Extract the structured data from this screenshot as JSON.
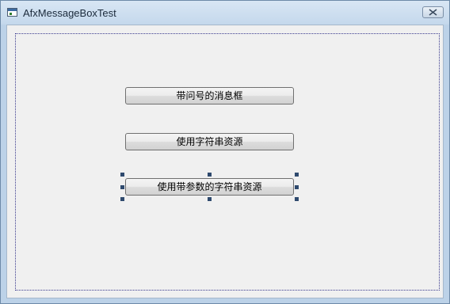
{
  "window": {
    "title": "AfxMessageBoxTest",
    "icons": {
      "app": "application-window-icon",
      "close": "close-x-icon"
    }
  },
  "dialog": {
    "buttons": [
      {
        "label": "带问号的消息框"
      },
      {
        "label": "使用字符串资源"
      },
      {
        "label": "使用带参数的字符串资源"
      }
    ],
    "selected_button_index": 2
  },
  "colors": {
    "title_bar": "#c4d8ec",
    "client_background": "#f0f0f0",
    "selection_handle": "#2f4a6e",
    "dialog_frame_dots": "#3a3a8e"
  }
}
